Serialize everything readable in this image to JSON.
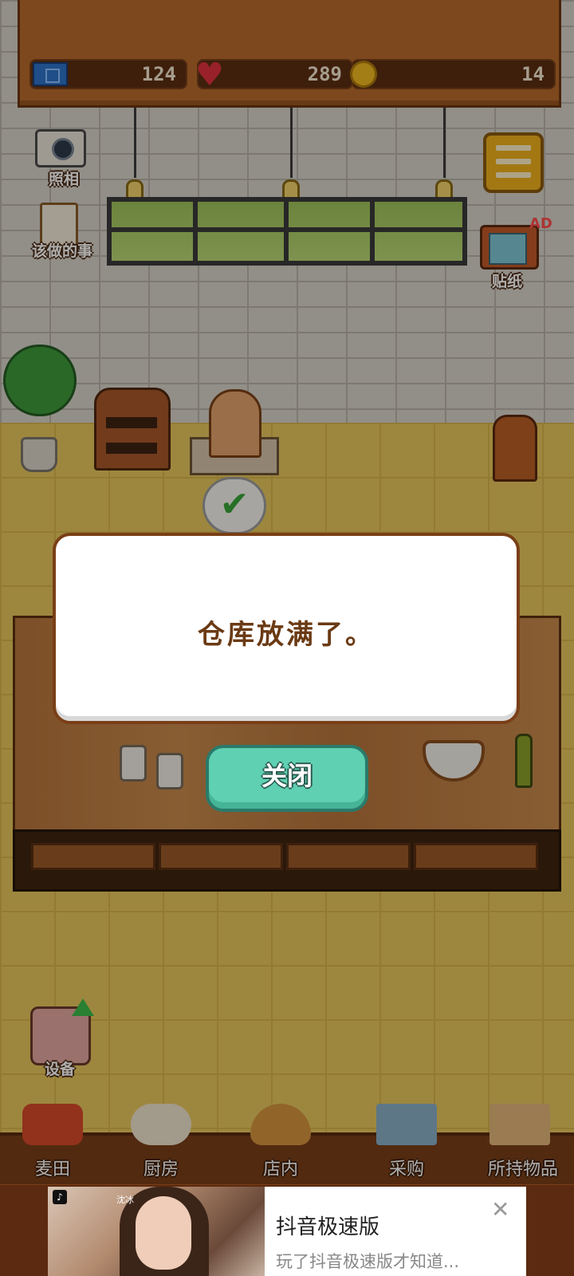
{
  "stats": {
    "tickets": "124",
    "hearts": "289",
    "coins": "14"
  },
  "side": {
    "photo_label": "照相",
    "todo_label": "该做的事",
    "sticker_label": "贴纸",
    "ad_badge": "AD",
    "equipment_label": "设备"
  },
  "dialog": {
    "message": "仓库放满了。",
    "close_label": "关闭"
  },
  "nav": {
    "items": [
      {
        "label": "麦田",
        "color": "#d74a2a"
      },
      {
        "label": "厨房",
        "color": "#efe3cc"
      },
      {
        "label": "店内",
        "color": "#d6953e"
      },
      {
        "label": "采购",
        "color": "#8ab0c8"
      },
      {
        "label": "所持物品",
        "color": "#e3b67a"
      }
    ]
  },
  "ad": {
    "app_logo_glyph": "♪",
    "caption": "沈冰",
    "title": "抖音极速版",
    "subtitle": "玩了抖音极速版才知道..."
  },
  "colors": {
    "wood": "#b86a2c",
    "floor": "#e8c75e",
    "button_teal": "#5fd0b2",
    "dialog_text": "#6a3a14"
  }
}
